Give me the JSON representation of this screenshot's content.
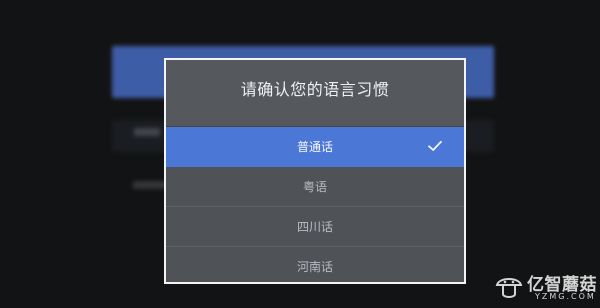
{
  "dialog": {
    "title": "请确认您的语言习惯",
    "options": [
      {
        "label": "普通话",
        "selected": true
      },
      {
        "label": "粤语",
        "selected": false
      },
      {
        "label": "四川话",
        "selected": false
      },
      {
        "label": "河南话",
        "selected": false
      }
    ]
  },
  "watermark": {
    "brand": "亿智蘑菇",
    "domain": "YZMG.COM"
  },
  "colors": {
    "background": "#121314",
    "dialog_bg": "#4e5156",
    "selected_row": "#4b78d7",
    "dialog_border": "#f4f4f4"
  },
  "icons": {
    "selected_marker": "check-icon",
    "watermark_logo": "mushroom-logo-icon"
  }
}
